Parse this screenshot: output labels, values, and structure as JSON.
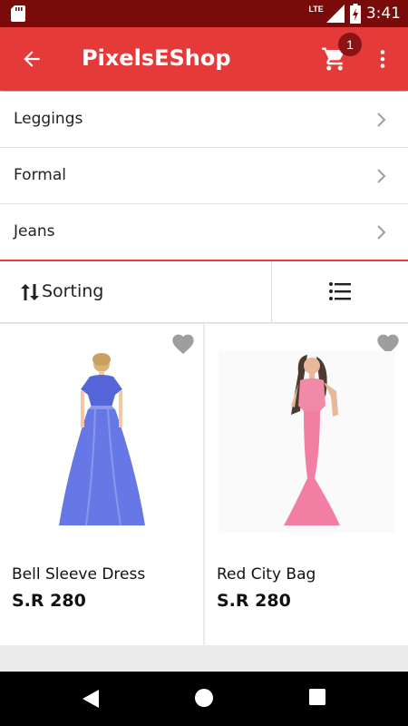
{
  "status_bar": {
    "time": "3:41",
    "network": "LTE"
  },
  "app_bar": {
    "title": "PixelsEShop",
    "cart_count": "1"
  },
  "categories": [
    {
      "label": "Leggings"
    },
    {
      "label": "Formal"
    },
    {
      "label": "Jeans"
    }
  ],
  "toolbar": {
    "sort_label": "Sorting"
  },
  "products": [
    {
      "name": "Bell Sleeve Dress",
      "price": "S.R 280"
    },
    {
      "name": "Red City Bag",
      "price": "S.R 280"
    }
  ],
  "colors": {
    "primary": "#e53a3a",
    "status_bar": "#7a0b0b",
    "badge": "#8a1414"
  }
}
